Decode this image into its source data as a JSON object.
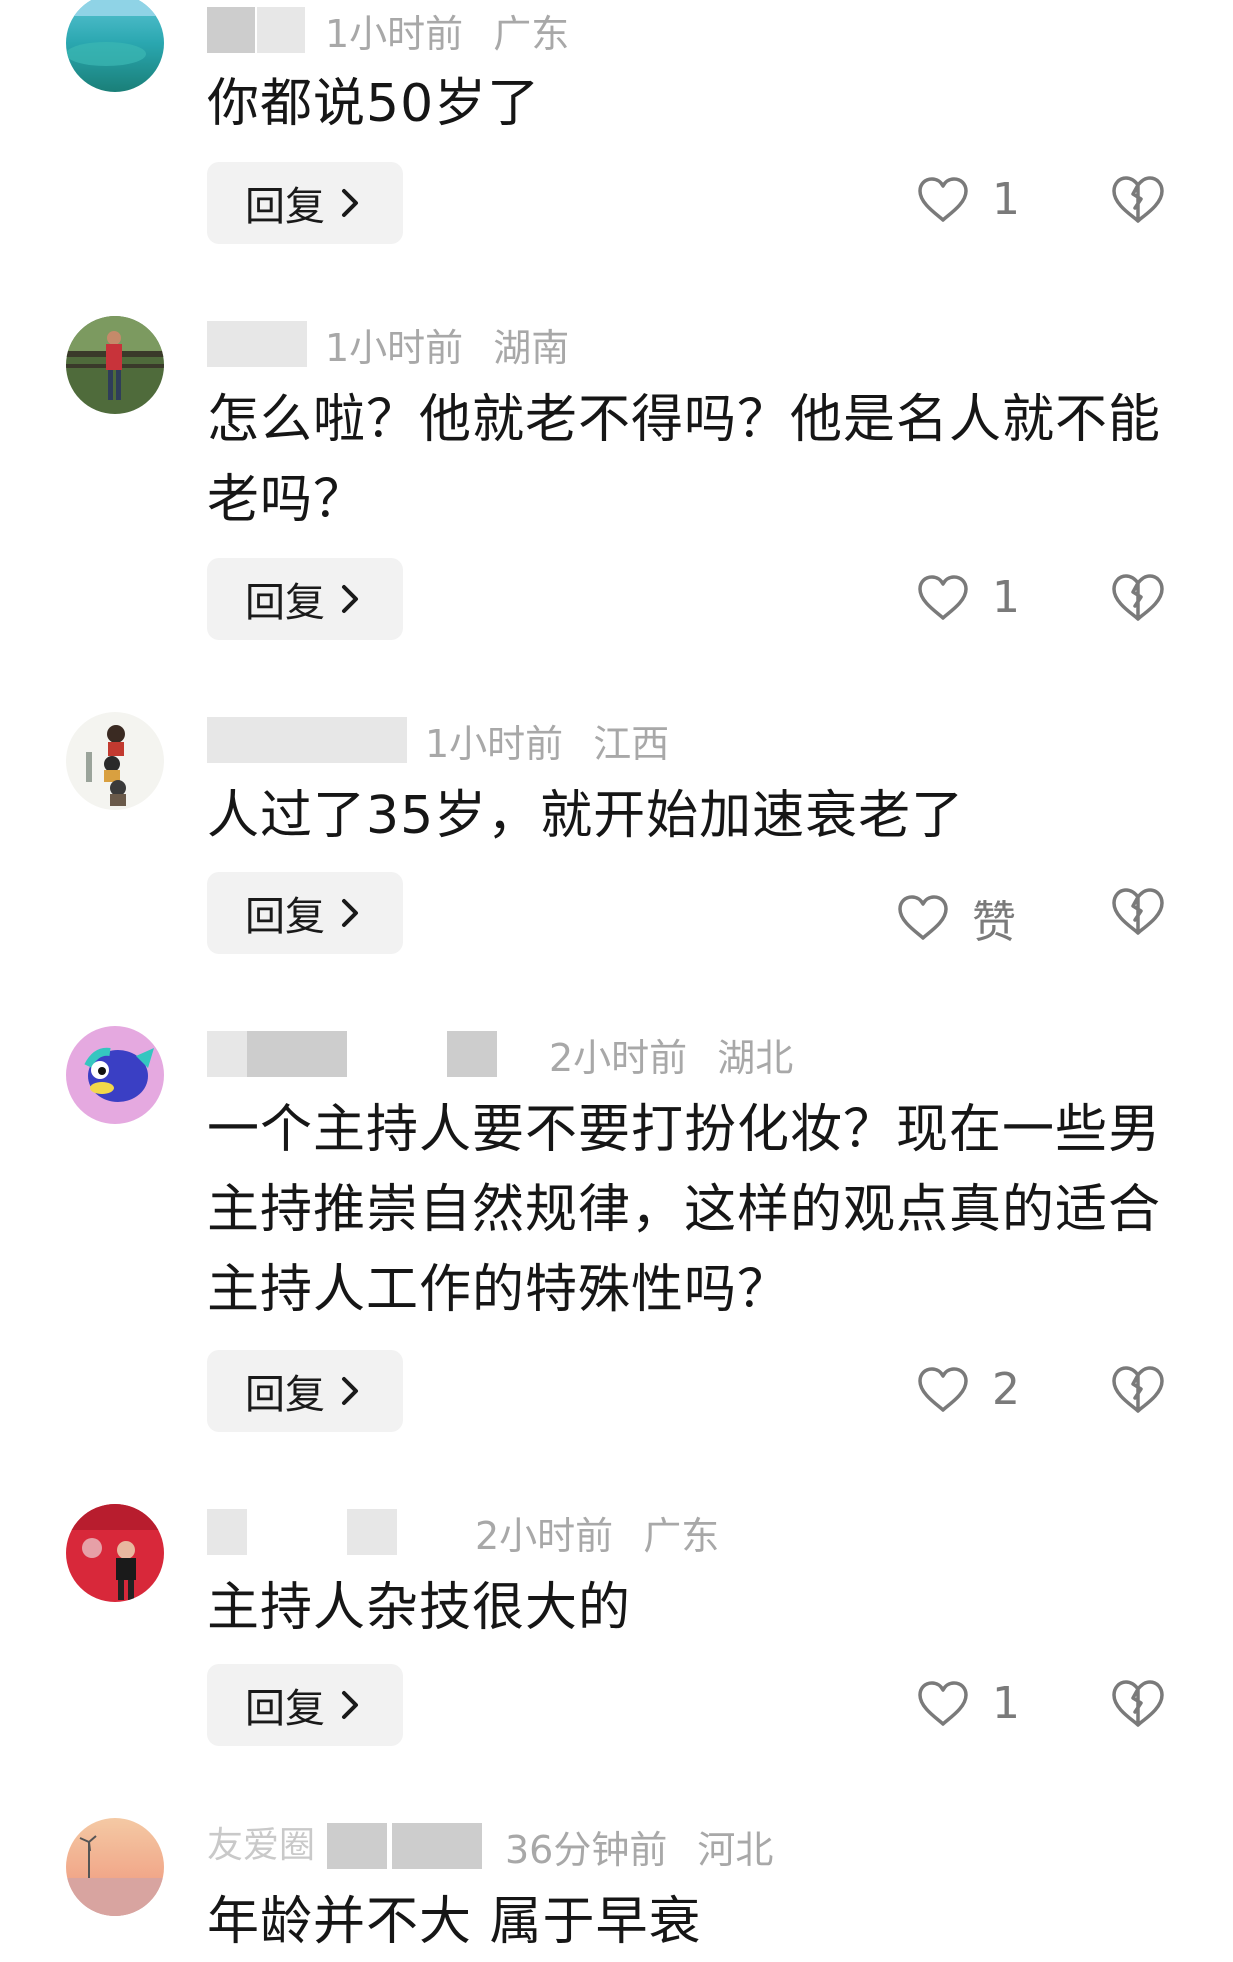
{
  "comments": [
    {
      "username": "",
      "time": "1小时前",
      "region": "广东",
      "text": "你都说50岁了",
      "reply_label": "回复",
      "like_label": "1"
    },
    {
      "username": "",
      "time": "1小时前",
      "region": "湖南",
      "text": "怎么啦？他就老不得吗？他是名人就不能老吗？",
      "reply_label": "回复",
      "like_label": "1"
    },
    {
      "username": "",
      "time": "1小时前",
      "region": "江西",
      "text": "人过了35岁，就开始加速衰老了",
      "reply_label": "回复",
      "like_label": "赞"
    },
    {
      "username": "",
      "time": "2小时前",
      "region": "湖北",
      "text": "一个主持人要不要打扮化妆？现在一些男主持推崇自然规律，这样的观点真的适合主持人工作的特殊性吗？",
      "reply_label": "回复",
      "like_label": "2"
    },
    {
      "username": "",
      "time": "2小时前",
      "region": "广东",
      "text": "主持人杂技很大的",
      "reply_label": "回复",
      "like_label": "1"
    },
    {
      "username": "友爱圈",
      "time": "36分钟前",
      "region": "河北",
      "text": "年龄并不大 属于早衰",
      "reply_label": "",
      "like_label": ""
    }
  ],
  "colors": {
    "text": "#161616",
    "meta": "#a8a8a8",
    "button_bg": "#f2f2f2",
    "icon": "#7a7a7a"
  },
  "icons": {
    "like": "heart-outline-icon",
    "dislike": "broken-heart-icon",
    "reply_chevron": "chevron-right-icon"
  }
}
